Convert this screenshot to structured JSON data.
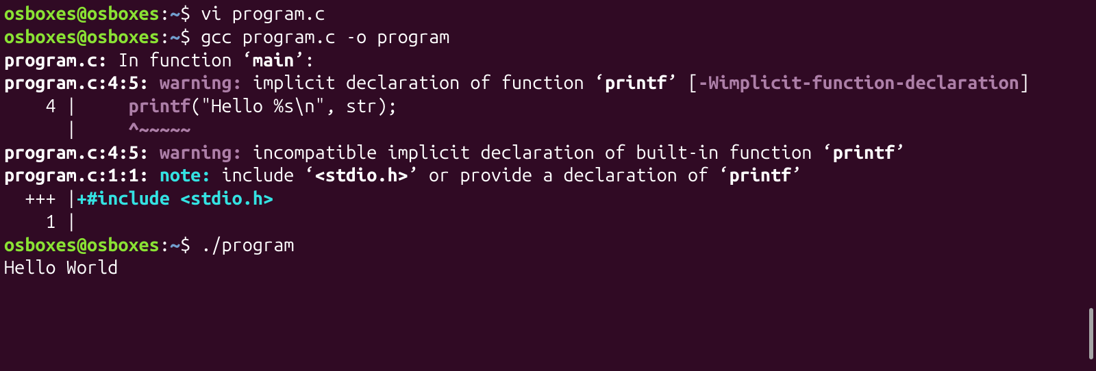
{
  "prompt": {
    "user_host": "osboxes@osboxes",
    "colon": ":",
    "path": "~",
    "dollar": "$ "
  },
  "commands": {
    "cmd1": "vi program.c",
    "cmd2": "gcc program.c -o program",
    "cmd3": "./program"
  },
  "gcc_output": {
    "line1_a": "program.c:",
    "line1_b": " In function ",
    "line1_c_q": "‘",
    "line1_c": "main",
    "line1_d": "’:",
    "line2_a": "program.c:4:5:",
    "line2_b": " ",
    "line2_warning": "warning:",
    "line2_c": " implicit declaration of function ",
    "line2_d_q": "‘",
    "line2_d": "printf",
    "line2_e": "’ [",
    "line2_flag": "-Wimplicit-function-declaration",
    "line3_a": "]",
    "line4_a": "    4 |     ",
    "line4_printf": "printf",
    "line4_b": "(\"Hello %s\\n\", str);",
    "line5_a": "      |     ",
    "line5_caret": "^~~~~~",
    "line6_a": "program.c:4:5:",
    "line6_b": " ",
    "line6_warning": "warning:",
    "line6_c": " incompatible implicit declaration of built-in function ",
    "line6_d_q": "‘",
    "line6_d": "printf",
    "line6_e": "’",
    "line7_a": "program.c:1:1:",
    "line7_b": " ",
    "line7_note": "note:",
    "line7_c": " include ",
    "line7_d_q": "‘",
    "line7_d": "<stdio.h>",
    "line7_e": "’ or provide a declaration of ",
    "line7_f_q": "‘",
    "line7_f": "printf",
    "line7_g": "’",
    "line8_a": "  +++ |",
    "line8_plus": "+",
    "line8_include": "#include <stdio.h>",
    "line9_a": "    1 |"
  },
  "program_output": {
    "line1": "Hello World"
  }
}
